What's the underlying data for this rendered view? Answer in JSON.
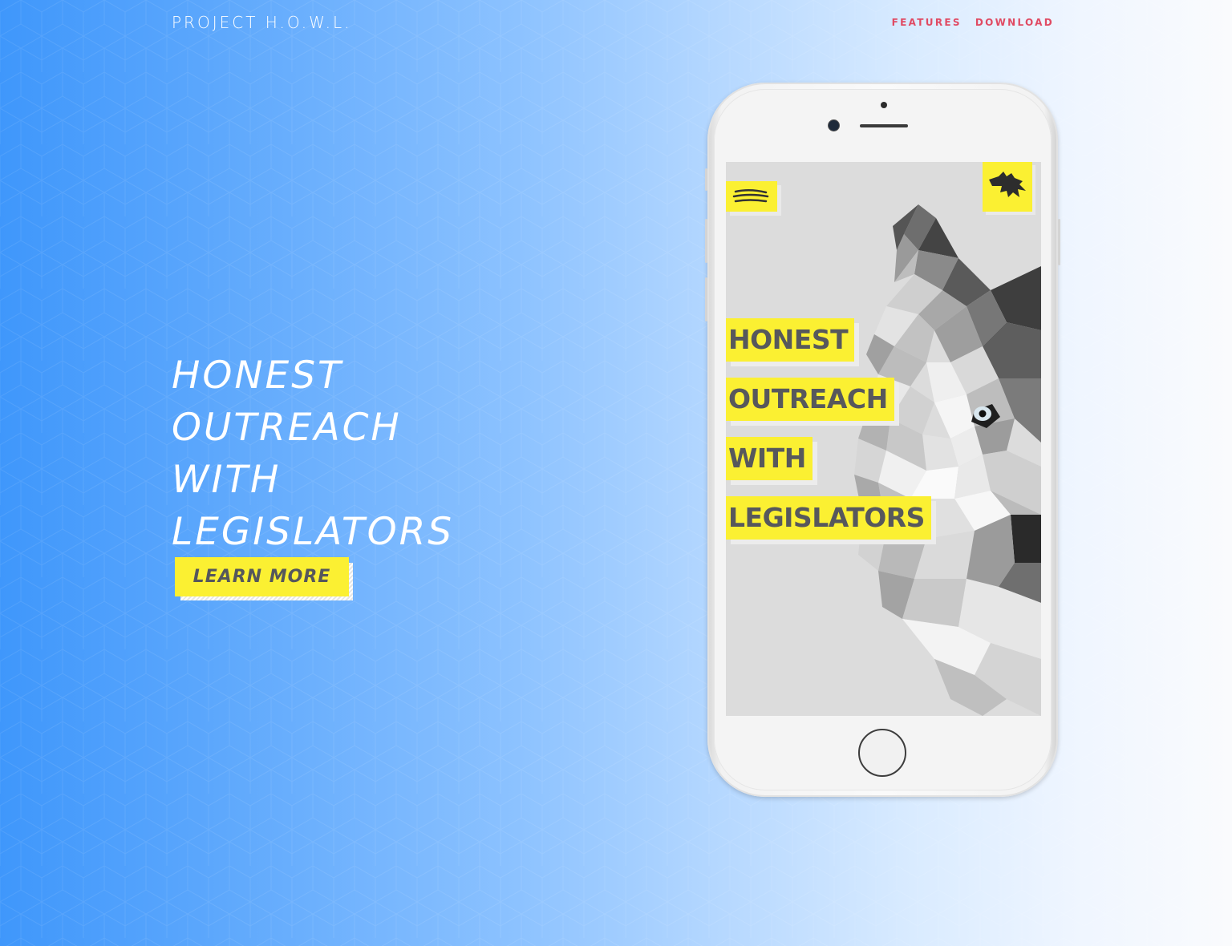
{
  "brand": "PROJECT H.O.W.L.",
  "nav": {
    "features": "FEATURES",
    "download": "DOWNLOAD"
  },
  "hero": {
    "lines": [
      "HONEST",
      "OUTREACH",
      "WITH",
      "LEGISLATORS"
    ],
    "cta": "LEARN MORE"
  },
  "phone_screen": {
    "lines": [
      "HONEST",
      "OUTREACH",
      "WITH",
      "LEGISLATORS"
    ],
    "menu_icon": "claw-menu-icon",
    "logo_icon": "wolf-head-icon"
  },
  "colors": {
    "accent_yellow": "#fbf032",
    "nav_pink": "#e04a63",
    "text_gray": "#57585c"
  }
}
